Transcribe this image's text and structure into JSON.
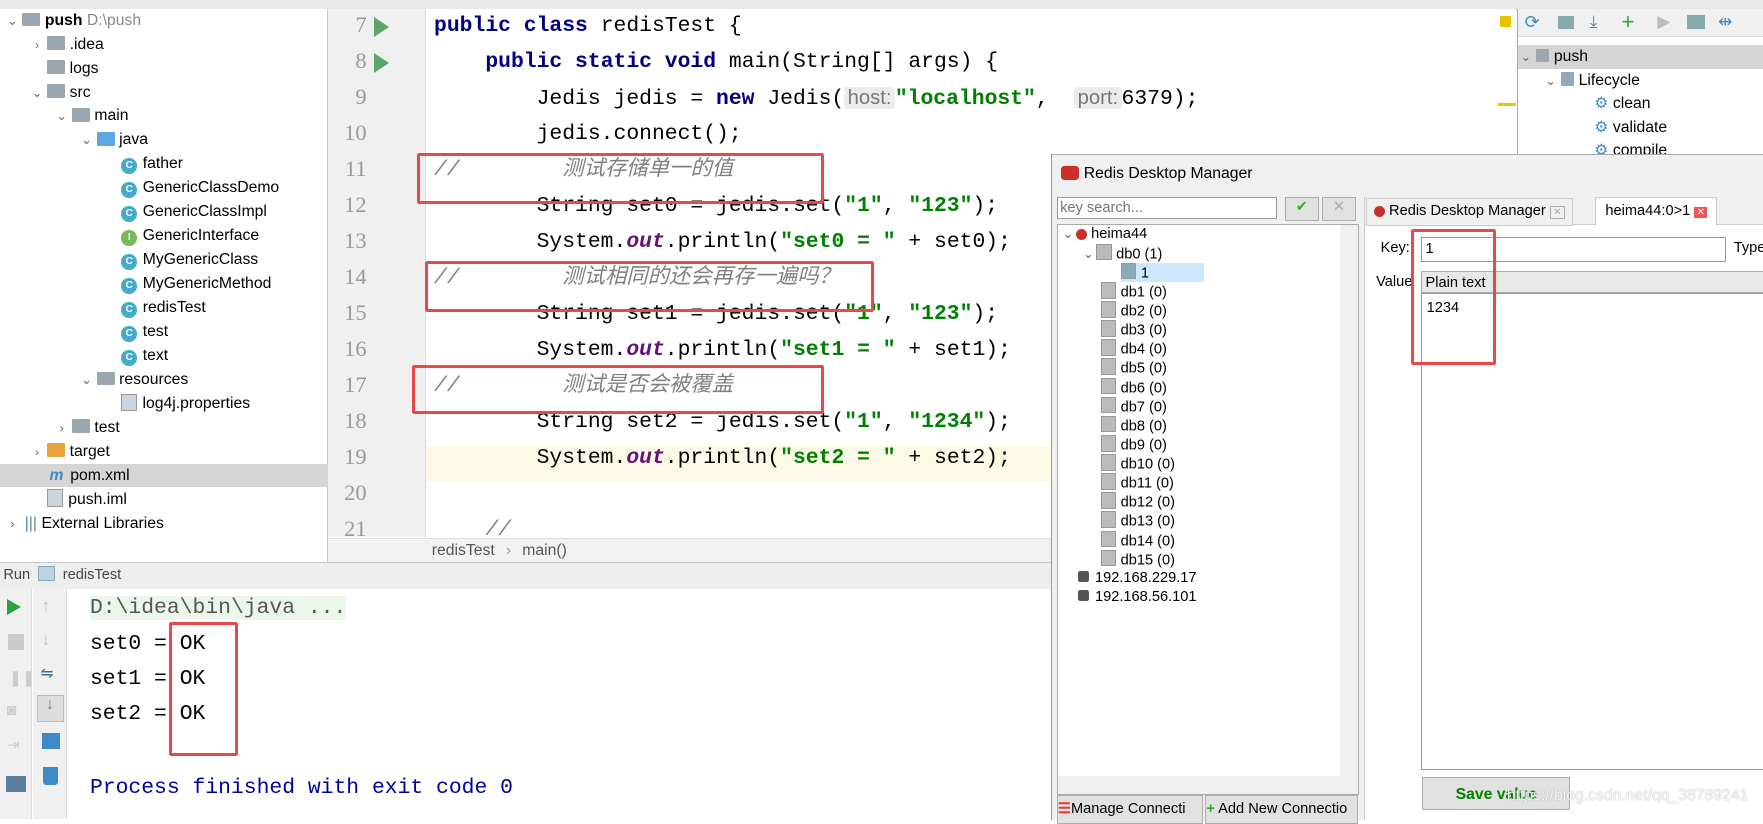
{
  "project": {
    "root": {
      "name": "push",
      "path": "D:\\push"
    },
    "items": [
      {
        "label": ".idea",
        "type": "folder",
        "depth": 1,
        "expanded": false
      },
      {
        "label": "logs",
        "type": "folder",
        "depth": 1,
        "expanded": null
      },
      {
        "label": "src",
        "type": "folder",
        "depth": 1,
        "expanded": true
      },
      {
        "label": "main",
        "type": "folder",
        "depth": 2,
        "expanded": true
      },
      {
        "label": "java",
        "type": "source-folder",
        "depth": 3,
        "expanded": true
      },
      {
        "label": "father",
        "type": "class",
        "depth": 4
      },
      {
        "label": "GenericClassDemo",
        "type": "class",
        "depth": 4
      },
      {
        "label": "GenericClassImpl",
        "type": "class",
        "depth": 4
      },
      {
        "label": "GenericInterface",
        "type": "interface",
        "depth": 4
      },
      {
        "label": "MyGenericClass",
        "type": "class",
        "depth": 4
      },
      {
        "label": "MyGenericMethod",
        "type": "class",
        "depth": 4
      },
      {
        "label": "redisTest",
        "type": "class",
        "depth": 4
      },
      {
        "label": "test",
        "type": "class",
        "depth": 4
      },
      {
        "label": "text",
        "type": "class",
        "depth": 4
      },
      {
        "label": "resources",
        "type": "folder",
        "depth": 3,
        "expanded": true
      },
      {
        "label": "log4j.properties",
        "type": "properties",
        "depth": 4
      },
      {
        "label": "test",
        "type": "folder",
        "depth": 2,
        "expanded": false
      },
      {
        "label": "target",
        "type": "target-folder",
        "depth": 1,
        "expanded": false
      },
      {
        "label": "pom.xml",
        "type": "maven",
        "depth": 1,
        "selected": true
      },
      {
        "label": "push.iml",
        "type": "iml",
        "depth": 1
      },
      {
        "label": "External Libraries",
        "type": "libraries",
        "depth": 0,
        "expanded": false
      }
    ]
  },
  "editor": {
    "lines": [
      {
        "n": "7",
        "run": true,
        "html": [
          [
            "kw",
            "public class "
          ],
          [
            "",
            "redisTest {"
          ]
        ]
      },
      {
        "n": "8",
        "run": true,
        "html": [
          [
            "",
            "    "
          ],
          [
            "kw",
            "public static void "
          ],
          [
            "",
            "main(String[] args) {"
          ]
        ]
      },
      {
        "n": "9",
        "html": [
          [
            "",
            "        Jedis jedis = "
          ],
          [
            "kw",
            "new "
          ],
          [
            "",
            "Jedis("
          ],
          [
            "hint",
            "host:"
          ],
          [
            "st",
            "\"localhost\""
          ],
          [
            "",
            ",  "
          ],
          [
            "hint",
            "port:"
          ],
          [
            "",
            "6379);"
          ]
        ]
      },
      {
        "n": "10",
        "html": [
          [
            "",
            "        jedis.connect();"
          ]
        ]
      },
      {
        "n": "11",
        "html": [
          [
            "cm",
            "//        测试存储单一的值"
          ]
        ]
      },
      {
        "n": "12",
        "html": [
          [
            "",
            "        String set0 = jedis.set("
          ],
          [
            "st",
            "\"1\""
          ],
          [
            "",
            ", "
          ],
          [
            "st",
            "\"123\""
          ],
          [
            "",
            ");"
          ]
        ]
      },
      {
        "n": "13",
        "html": [
          [
            "",
            "        System."
          ],
          [
            "sf",
            "out"
          ],
          [
            "",
            ".println("
          ],
          [
            "st",
            "\"set0 = \""
          ],
          [
            "",
            " + set0);"
          ]
        ]
      },
      {
        "n": "14",
        "html": [
          [
            "cm",
            "//        测试相同的还会再存一遍吗？"
          ]
        ]
      },
      {
        "n": "15",
        "html": [
          [
            "",
            "        String set1 = jedis.set("
          ],
          [
            "st",
            "\"1\""
          ],
          [
            "",
            ", "
          ],
          [
            "st",
            "\"123\""
          ],
          [
            "",
            ");"
          ]
        ]
      },
      {
        "n": "16",
        "html": [
          [
            "",
            "        System."
          ],
          [
            "sf",
            "out"
          ],
          [
            "",
            ".println("
          ],
          [
            "st",
            "\"set1 = \""
          ],
          [
            "",
            " + set1);"
          ]
        ]
      },
      {
        "n": "17",
        "html": [
          [
            "cm",
            "//        测试是否会被覆盖"
          ]
        ]
      },
      {
        "n": "18",
        "html": [
          [
            "",
            "        String set2 = jedis.set("
          ],
          [
            "st",
            "\"1\""
          ],
          [
            "",
            ", "
          ],
          [
            "st",
            "\"1234\""
          ],
          [
            "",
            ");"
          ]
        ]
      },
      {
        "n": "19",
        "html": [
          [
            "",
            "        System."
          ],
          [
            "sf",
            "out"
          ],
          [
            "",
            ".println("
          ],
          [
            "st",
            "\"set2 = \""
          ],
          [
            "",
            " + set2);"
          ]
        ]
      },
      {
        "n": "20",
        "html": []
      },
      {
        "n": "21",
        "html": [
          [
            "cm",
            "    //"
          ]
        ]
      }
    ],
    "breadcrumb": [
      "redisTest",
      "main()"
    ]
  },
  "maven": {
    "root": "push",
    "lifecycle": "Lifecycle",
    "goals": [
      "clean",
      "validate",
      "compile"
    ]
  },
  "run": {
    "label": "Run",
    "config": "redisTest",
    "command": "D:\\idea\\bin\\java ...",
    "output": [
      {
        "k": "set0 = ",
        "v": "OK"
      },
      {
        "k": "set1 = ",
        "v": "OK"
      },
      {
        "k": "set2 = ",
        "v": "OK"
      }
    ],
    "exit": "Process finished with exit code 0"
  },
  "rdm": {
    "title": "Redis Desktop Manager",
    "search_placeholder": "key search...",
    "connection": "heima44",
    "db0": "db0 (1)",
    "key_item": "1",
    "dbs": [
      "db1 (0)",
      "db2 (0)",
      "db3 (0)",
      "db4 (0)",
      "db5 (0)",
      "db6 (0)",
      "db7 (0)",
      "db8 (0)",
      "db9 (0)",
      "db10 (0)",
      "db11 (0)",
      "db12 (0)",
      "db13 (0)",
      "db14 (0)",
      "db15 (0)"
    ],
    "other_connections": [
      "192.168.229.17",
      "192.168.56.101"
    ],
    "manage_button": "Manage Connecti",
    "add_button": "Add New Connectio",
    "tabs": [
      "Redis Desktop Manager",
      "heima44:0>1"
    ],
    "key_label": "Key:",
    "key_value": "1",
    "type_label": "Type",
    "value_label": "Value",
    "format": "Plain text",
    "value": "1234",
    "save_button": "Save value"
  },
  "watermark": "https://blog.csdn.net/qq_38789241",
  "colors": {
    "highlight_box": "#e8474b",
    "keyword": "#000080",
    "string": "#008000",
    "comment": "#808080",
    "save_text": "#008000"
  }
}
